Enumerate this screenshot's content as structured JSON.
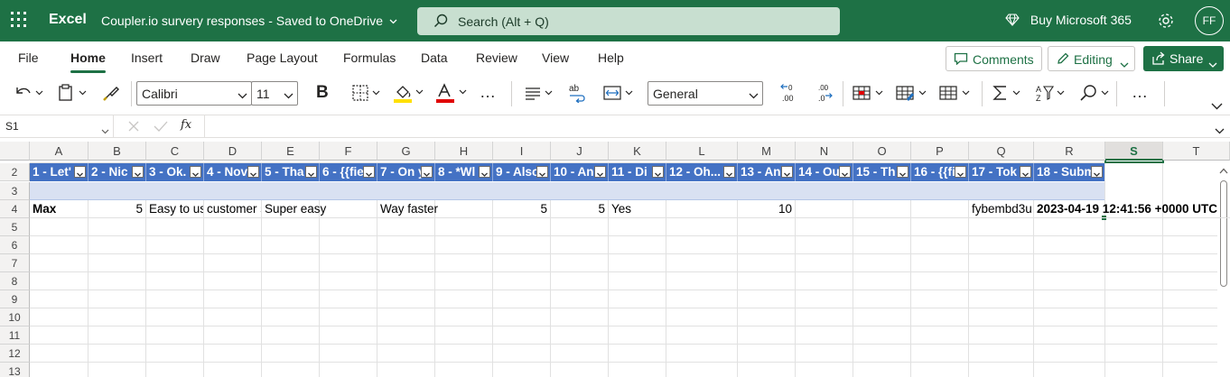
{
  "titlebar": {
    "app_name": "Excel",
    "doc_title": "Coupler.io survery responses",
    "doc_status": "-  Saved to OneDrive",
    "search_placeholder": "Search (Alt + Q)",
    "buy": "Buy Microsoft 365",
    "avatar": "FF",
    "bg": "#1e7145"
  },
  "tabs": [
    "File",
    "Home",
    "Insert",
    "Draw",
    "Page Layout",
    "Formulas",
    "Data",
    "Review",
    "View",
    "Help"
  ],
  "active_tab": "Home",
  "actions": {
    "comments": "Comments",
    "editing": "Editing",
    "share": "Share"
  },
  "toolbar": {
    "font": "Calibri",
    "size": "11",
    "bold": "B",
    "number_format": "General",
    "more": "…"
  },
  "formula_bar": {
    "name_box": "S1",
    "fx": "fx",
    "value": ""
  },
  "grid": {
    "columns": [
      "A",
      "B",
      "C",
      "D",
      "E",
      "F",
      "G",
      "H",
      "I",
      "J",
      "K",
      "L",
      "M",
      "N",
      "O",
      "P",
      "Q",
      "R",
      "S",
      "T"
    ],
    "selected_column": "S",
    "rows": [
      "2",
      "3",
      "4",
      "5",
      "6",
      "7",
      "8",
      "9",
      "10",
      "11",
      "12",
      "13"
    ],
    "header_row": [
      "1 - Let'",
      "2 - Nic",
      "3 - Ok.",
      "4 - Nov",
      "5 - Tha",
      "6 - {{fie",
      "7 - On y",
      "8 - *Wl",
      "9 - Also",
      "10 - An",
      "11 - Di",
      "12 - Oh...",
      "13 - An",
      "14 - Ou",
      "15 - Th",
      "16 - {{fi",
      "17 - Tok",
      "18 - Subm"
    ],
    "row4": {
      "A": "Max",
      "B": "5",
      "C": "Easy to use",
      "D": "customer s",
      "E": "Super easy",
      "G": "Way faster",
      "I": "5",
      "J": "5",
      "K": "Yes",
      "M": "10",
      "Q": "fybembd3u",
      "R": "2023-04-19 12:41:56 +0000 UTC"
    },
    "header_color": "#4472c4",
    "band_color": "#d9e1f2"
  }
}
